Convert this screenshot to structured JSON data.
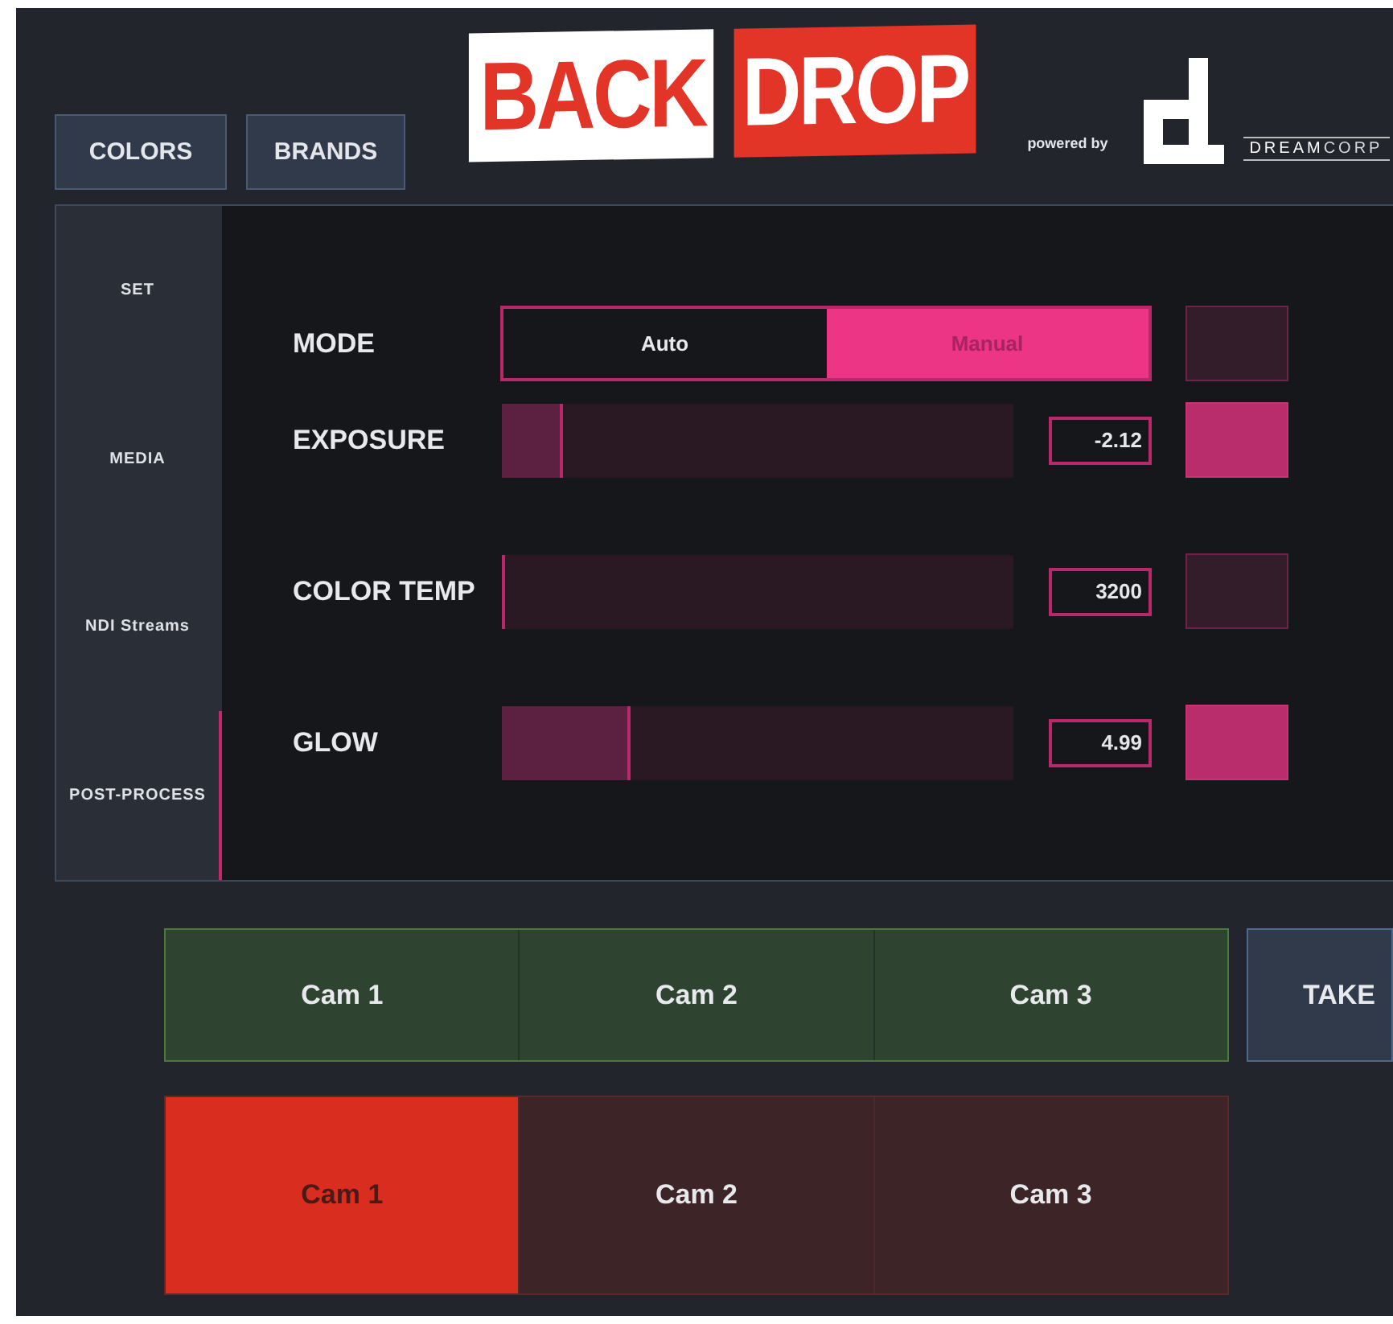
{
  "header": {
    "buttons": [
      "COLORS",
      "BRANDS"
    ],
    "logo": {
      "left": "BACK",
      "right": "DROP"
    },
    "powered_by": "powered by",
    "brand": "**DREAM**CORP"
  },
  "sidebar": {
    "items": [
      {
        "label": "SET",
        "selected": false
      },
      {
        "label": "MEDIA",
        "selected": false
      },
      {
        "label": "NDI Streams",
        "selected": false
      },
      {
        "label": "POST-PROCESS",
        "selected": true
      }
    ]
  },
  "controls": [
    {
      "kind": "segmented",
      "label": "MODE",
      "options": [
        {
          "label": "Auto",
          "selected": false
        },
        {
          "label": "Manual",
          "selected": true
        }
      ],
      "on": false
    },
    {
      "kind": "slider",
      "label": "EXPOSURE",
      "level": 0.12,
      "value": "-2.12",
      "on": true
    },
    {
      "kind": "slider",
      "label": "COLOR TEMP",
      "level": 0,
      "value": "3200",
      "on": false
    },
    {
      "kind": "slider",
      "label": "GLOW",
      "level": 0.25,
      "value": "4.99",
      "on": true
    }
  ],
  "preview": [
    {
      "label": "Cam 1",
      "selected": false
    },
    {
      "label": "Cam 2",
      "selected": false
    },
    {
      "label": "Cam 3",
      "selected": false
    }
  ],
  "take": "TAKE",
  "program": [
    {
      "label": "Cam 1",
      "selected": true
    },
    {
      "label": "Cam 2",
      "selected": false
    },
    {
      "label": "Cam 3",
      "selected": false
    }
  ]
}
